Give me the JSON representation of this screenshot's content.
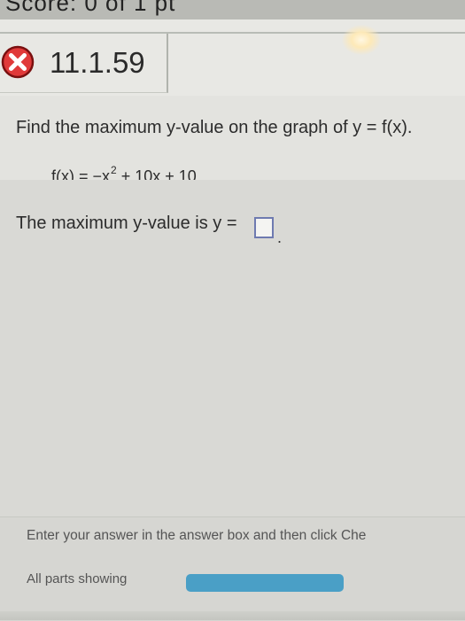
{
  "score": "Score: 0 of 1 pt",
  "question": {
    "id": "11.1.59",
    "status": "incorrect",
    "status_icon": "x-circle-icon",
    "status_color": "#e03a3a",
    "prompt": "Find the maximum y-value on the graph of y = f(x).",
    "function_lhs": "f(x) = −x",
    "function_exponent": "2",
    "function_rest": "+ 10x + 10",
    "answer_prefix": "The maximum y-value is y =",
    "answer_value": "",
    "answer_suffix": "."
  },
  "footer": {
    "instruction": "Enter your answer in the answer box and then click Che",
    "parts_label": "All parts showing",
    "progress_color": "#4a9fc6"
  }
}
